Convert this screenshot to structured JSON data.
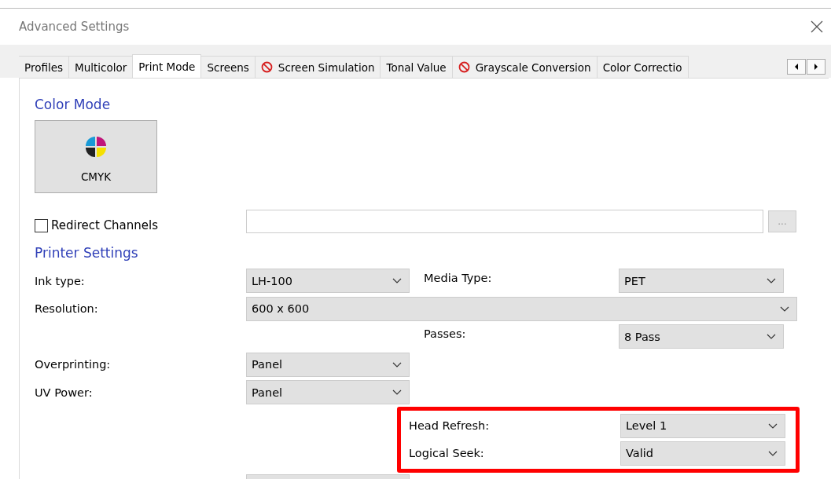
{
  "window": {
    "title": "Advanced Settings"
  },
  "tabs": [
    {
      "label": "Profiles",
      "selected": false,
      "blocked": false
    },
    {
      "label": "Multicolor",
      "selected": false,
      "blocked": false
    },
    {
      "label": "Print Mode",
      "selected": true,
      "blocked": false
    },
    {
      "label": "Screens",
      "selected": false,
      "blocked": false
    },
    {
      "label": "Screen Simulation",
      "selected": false,
      "blocked": true
    },
    {
      "label": "Tonal Value",
      "selected": false,
      "blocked": false
    },
    {
      "label": "Grayscale Conversion",
      "selected": false,
      "blocked": true
    },
    {
      "label": "Color Correctio",
      "selected": false,
      "blocked": false
    }
  ],
  "color_mode": {
    "heading": "Color Mode",
    "button": "CMYK"
  },
  "redirect": {
    "label": "Redirect Channels",
    "checked": false,
    "browse": "..."
  },
  "printer_settings": {
    "heading": "Printer Settings",
    "rows": [
      {
        "left": {
          "label": "Ink type:",
          "value": "LH-100"
        },
        "right": {
          "label": "Media Type:",
          "value": "PET"
        }
      },
      {
        "left": {
          "label": "Resolution:",
          "value": "600 x 600",
          "wide": true
        }
      },
      {
        "right": {
          "label": "Passes:",
          "value": "8 Pass"
        }
      },
      {
        "left": {
          "label": "Overprinting:",
          "value": "Panel"
        }
      },
      {
        "left": {
          "label": "UV Power:",
          "value": "Panel"
        }
      }
    ],
    "highlight_box": [
      {
        "label": "Head Refresh:",
        "value": "Level 1"
      },
      {
        "label": "Logical Seek:",
        "value": "Valid"
      }
    ]
  }
}
